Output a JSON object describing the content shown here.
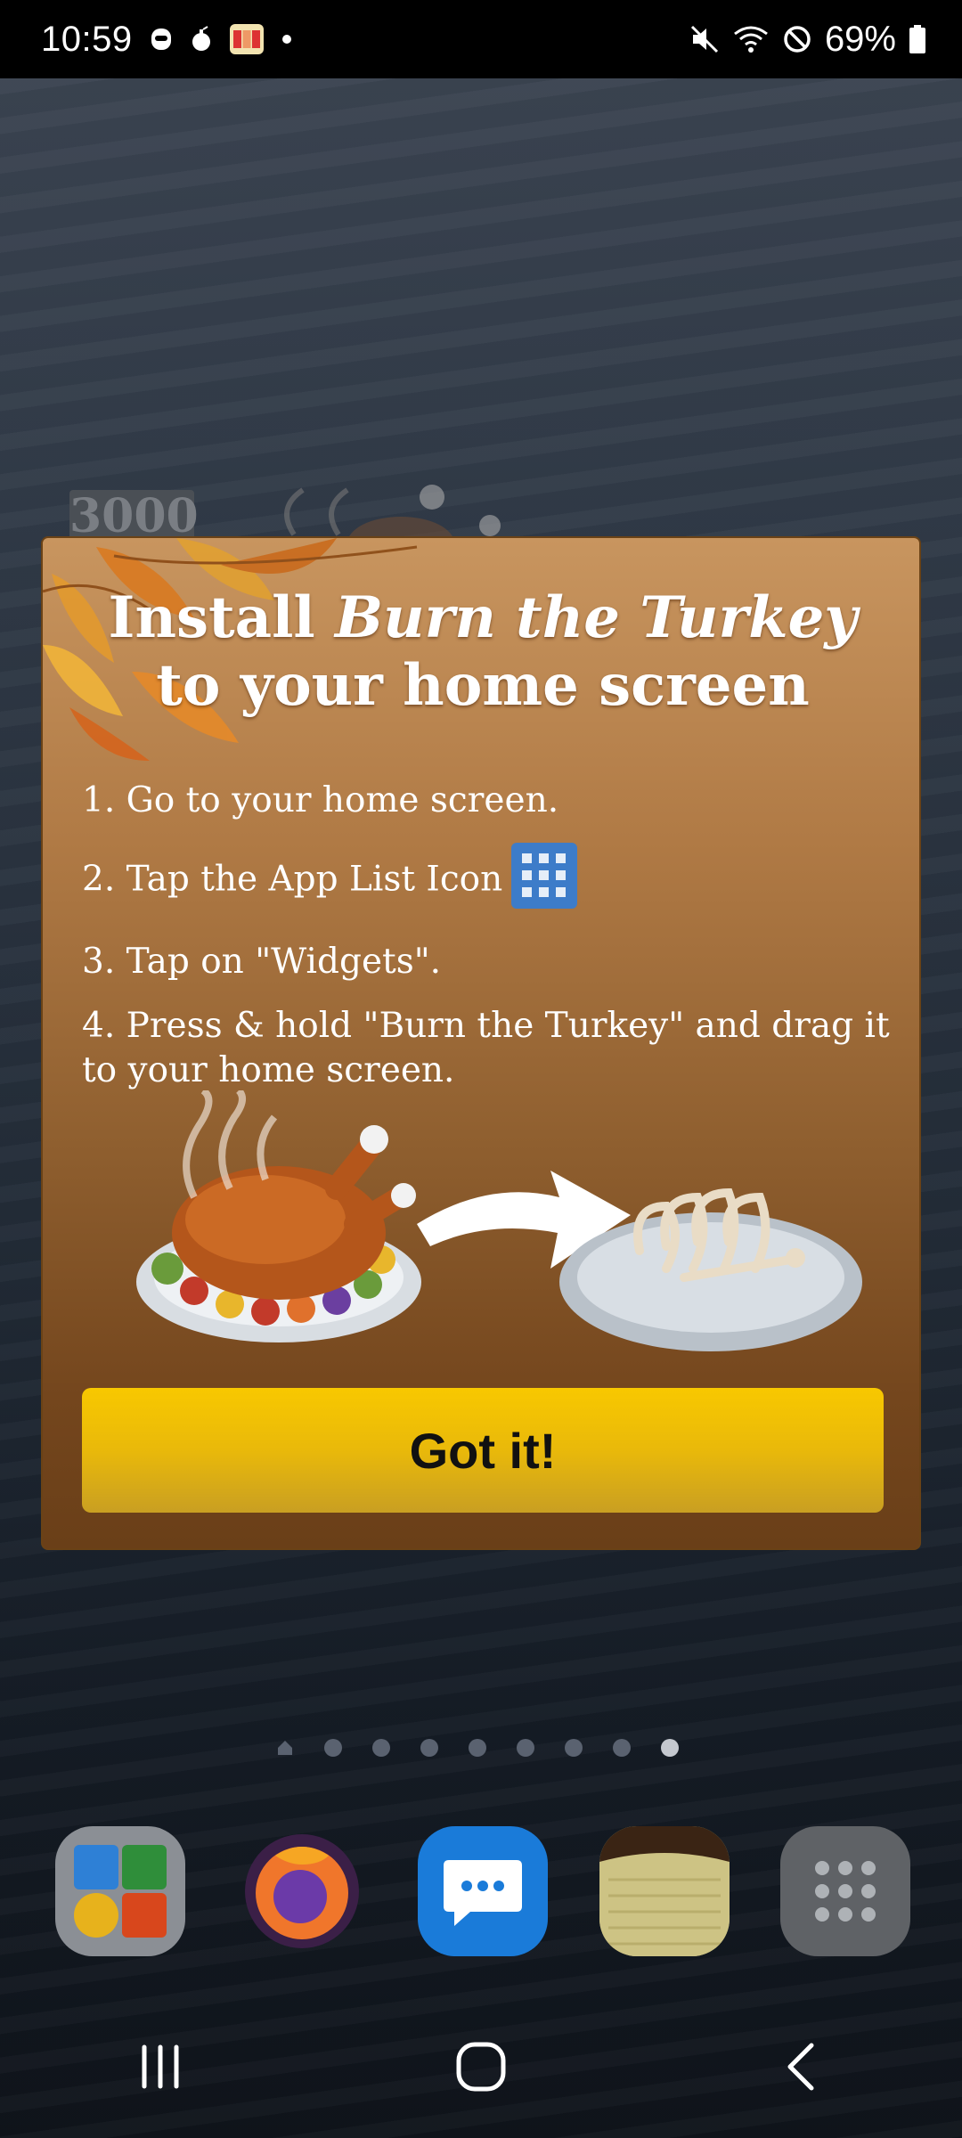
{
  "status_bar": {
    "time": "10:59",
    "battery": "69%",
    "left_icons": [
      "face-icon",
      "bomb-icon",
      "slots-app-icon",
      "dot-icon"
    ],
    "right_icons": [
      "mute-icon",
      "wifi-icon",
      "do-not-disturb-icon",
      "battery-icon"
    ]
  },
  "background_widget": {
    "score": "3000"
  },
  "dialog": {
    "title_prefix": "Install ",
    "title_app": "Burn the Turkey",
    "title_suffix": " to your home screen",
    "steps": [
      "1. Go to your home screen.",
      "2. Tap the App List Icon",
      "3. Tap on \"Widgets\".",
      "4. Press & hold \"Burn the Turkey\" and drag it to your home screen."
    ],
    "button_label": "Got it!"
  },
  "page_indicator": {
    "pages": 9,
    "active_index": 8
  },
  "dock": {
    "apps": [
      "multi-app-folder",
      "firefox",
      "messages",
      "notes",
      "app-drawer"
    ]
  },
  "nav_bar": {
    "buttons": [
      "recents",
      "home",
      "back"
    ]
  },
  "colors": {
    "button_yellow": "#f8c800",
    "dialog_brown": "#b07a45",
    "status_bar": "#000000"
  }
}
